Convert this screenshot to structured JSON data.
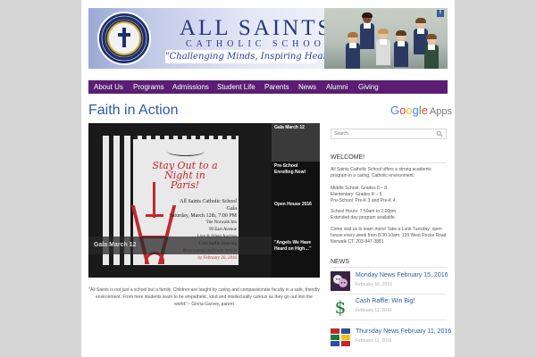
{
  "header": {
    "seal_text": "All Saints Catholic School · Norwalk, CT",
    "school_name": "ALL SAINTS",
    "school_sub": "CATHOLIC SCHOOL",
    "tagline": "\"Challenging Minds, Inspiring Hearts\"",
    "social_icon": "f"
  },
  "nav": {
    "items": [
      "About Us",
      "Programs",
      "Admissions",
      "Student Life",
      "Parents",
      "News",
      "Alumni",
      "Giving"
    ]
  },
  "main": {
    "section_title": "Faith in Action",
    "slider": {
      "active_caption": "Gala March 12",
      "tabs": [
        "Gala March 12",
        "Pre-School Enrolling Now!",
        "Open House 2016",
        "\"Angels We Have Heard on High…\""
      ],
      "poster": {
        "title_lines": [
          "Stay Out to a",
          "Night in Paris!"
        ],
        "info_lines": [
          "All Saints Catholic School Gala",
          "Saturday, March 12th, 7:00 PM",
          "The Norwalk Inn",
          "99 East Avenue",
          "Live & Silent Auction",
          "Cash Raffle Drawing",
          "Reservations and more details",
          "by February 26, 2016"
        ]
      },
      "slide_color_accent": "#c3282b"
    },
    "quote": "\"All Saints is not just a school but a family. Children are taught by caring and compassionate faculty in a safe, friendly environment. From here students learn to be empathetic, kind and intellectually curious as they go out into the world.\"– Gloria Garvey, parent"
  },
  "sidebar": {
    "google": {
      "g1": "G",
      "o1": "o",
      "o2": "o",
      "g2": "g",
      "l": "l",
      "e": "e",
      "apps": "Apps"
    },
    "search_placeholder": "Search...",
    "welcome_heading": "WELCOME!",
    "welcome_text": "All Saints Catholic School offers a strong academic program in a caring, Catholic environment.",
    "grades": [
      "Middle School: Grades 6 – 8",
      "Elementary: Grades K – 5",
      "Pre-School: Pre-K 3 and Pre-K 4"
    ],
    "hours": [
      "School Hours: 7:50am to 2:00pm.",
      "Extended day program available."
    ],
    "visit": "Come visit us to learn more! Take a Look Tuesday: open house every week from 8:30-10am. 139 West Rocks Road Norwalk CT. 203-847-3881",
    "news_heading": "NEWS",
    "news": [
      {
        "title": "Monday News February 15, 2016",
        "date": "February 16, 2016",
        "icon": "drama-masks-icon"
      },
      {
        "title": "Cash Raffle: Win Big!",
        "date": "February 11, 2016",
        "icon": "dollar-sign-icon"
      },
      {
        "title": "Thursday News February 11, 2016",
        "date": "February 11, 2016",
        "icon": "flags-icon"
      }
    ]
  },
  "colors": {
    "nav_bg": "#5a1e72",
    "link_blue": "#2a5ca8",
    "brand_navy": "#27367a"
  }
}
